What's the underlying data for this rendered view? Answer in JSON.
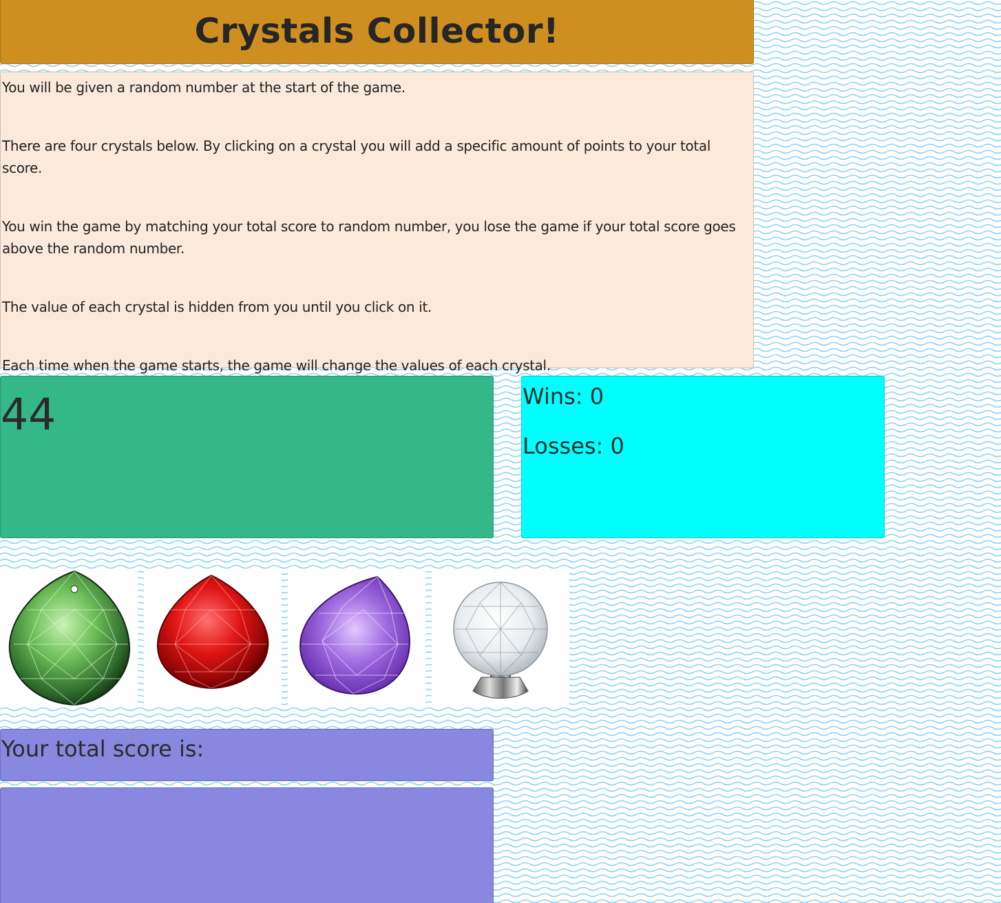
{
  "header": {
    "title": "Crystals Collector!"
  },
  "instructions": [
    "You will be given a random number at the start of the game.",
    "There are four crystals below. By clicking on a crystal you will add a specific amount of points to your total score.",
    "You win the game by matching your total score to random number, you lose the game if your total score goes above the random number.",
    "The value of each crystal is hidden from you until you click on it.",
    "Each time when the game starts, the game will change the values of each crystal."
  ],
  "game": {
    "target_number": "44",
    "wins_text": "Wins: 0",
    "losses_text": "Losses: 0",
    "wins": 0,
    "losses": 0,
    "score_label": "Your total score is:",
    "total_score": ""
  },
  "crystals": [
    {
      "name": "green-crystal-icon",
      "color": "#2f7a2f"
    },
    {
      "name": "red-crystal-icon",
      "color": "#d40d0d"
    },
    {
      "name": "purple-crystal-icon",
      "color": "#9a5ed8"
    },
    {
      "name": "clear-crystal-icon",
      "color": "#e6eaee"
    }
  ],
  "colors": {
    "header": "#cf8f20",
    "instructions": "#fbeadb",
    "target": "#34b889",
    "stats": "#00ffff",
    "score": "#8888e0"
  }
}
